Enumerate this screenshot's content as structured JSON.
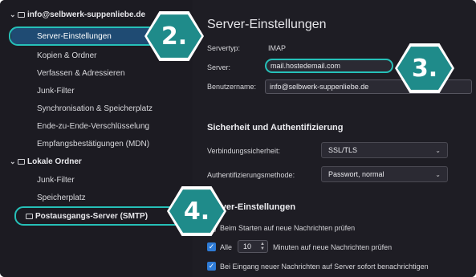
{
  "sidebar": {
    "account": "info@selbwerk-suppenliebe.de",
    "items": [
      "Server-Einstellungen",
      "Kopien & Ordner",
      "Verfassen & Adressieren",
      "Junk-Filter",
      "Synchronisation & Speicherplatz",
      "Ende-zu-Ende-Verschlüsselung",
      "Empfangsbestätigungen (MDN)"
    ],
    "local_folders": "Lokale Ordner",
    "local_items": [
      "Junk-Filter",
      "Speicherplatz"
    ],
    "smtp": "Postausgangs-Server (SMTP)"
  },
  "main": {
    "title": "Server-Einstellungen",
    "servertype_label": "Servertyp:",
    "servertype_value": "IMAP",
    "server_label": "Server:",
    "server_value": "mail.hostedemail.com",
    "username_label": "Benutzername:",
    "username_value": "info@selbwerk-suppenliebe.de",
    "security_title": "Sicherheit und Authentifizierung",
    "conn_label": "Verbindungssicherheit:",
    "conn_value": "SSL/TLS",
    "auth_label": "Authentifizierungsmethode:",
    "auth_value": "Passwort, normal",
    "server_settings_title": "Server-Einstellungen",
    "check_startup": "Beim Starten auf neue Nachrichten prüfen",
    "every_label": "Alle",
    "every_value": "10",
    "minutes_label": "Minuten auf neue Nachrichten prüfen",
    "notify_label": "Bei Eingang neuer Nachrichten auf Server sofort benachrichtigen"
  },
  "badges": [
    "2.",
    "3.",
    "4."
  ],
  "colors": {
    "accent": "#26c0b8",
    "badge": "#1f8b8a",
    "selection": "#1f4b73",
    "checkbox": "#2e7bd6"
  }
}
